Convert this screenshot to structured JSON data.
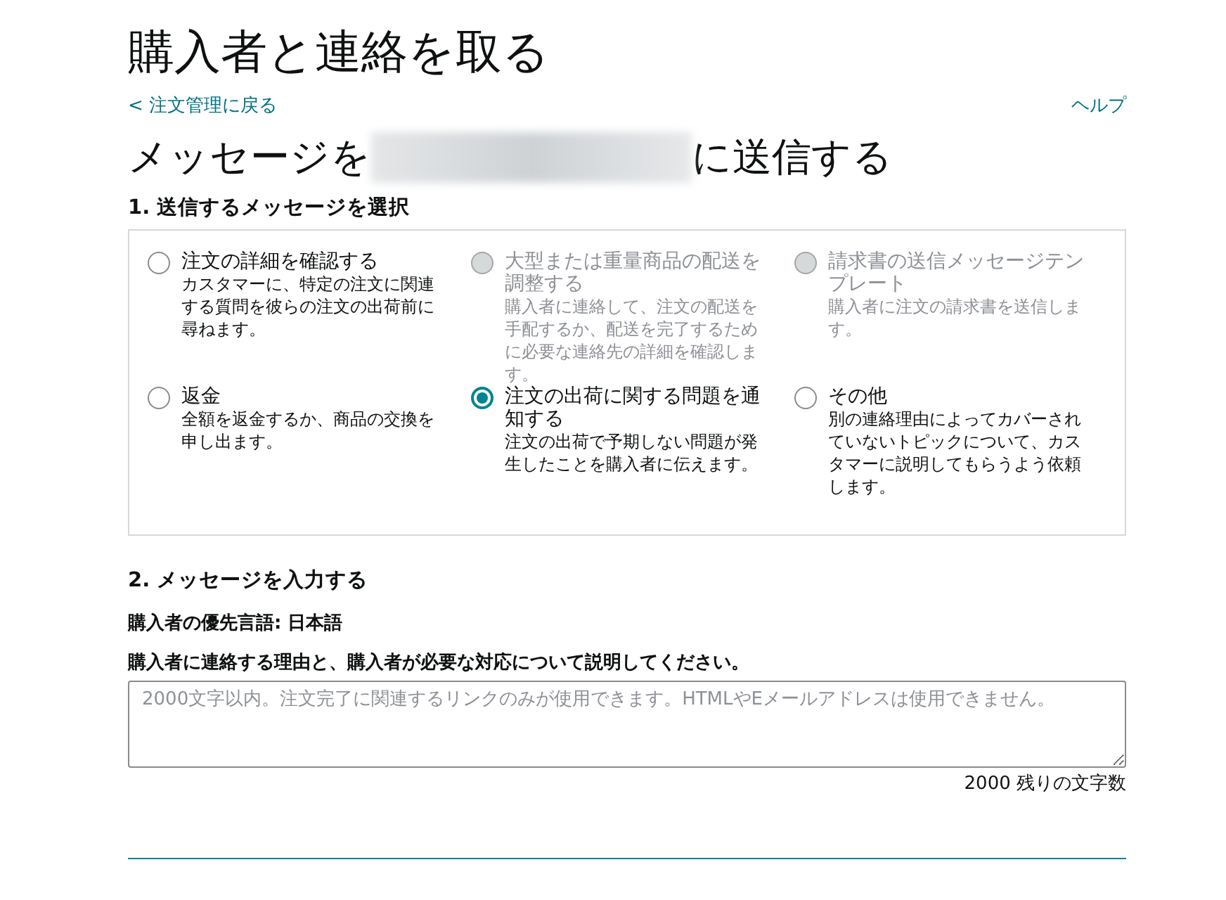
{
  "page_title": "購入者と連絡を取る",
  "back_link": "< 注文管理に戻る",
  "help_link": "ヘルプ",
  "heading": {
    "prefix": "メッセージを",
    "suffix": "に送信する"
  },
  "step1": {
    "title": "1. 送信するメッセージを選択",
    "options": [
      {
        "label": "注文の詳細を確認する",
        "description": "カスタマーに、特定の注文に関連する質問を彼らの注文の出荷前に尋ねます。",
        "selected": false,
        "disabled": false
      },
      {
        "label": "大型または重量商品の配送を調整する",
        "description": "購入者に連絡して、注文の配送を手配するか、配送を完了するために必要な連絡先の詳細を確認します。",
        "selected": false,
        "disabled": true
      },
      {
        "label": "請求書の送信メッセージテンプレート",
        "description": "購入者に注文の請求書を送信します。",
        "selected": false,
        "disabled": true
      },
      {
        "label": "返金",
        "description": "全額を返金するか、商品の交換を申し出ます。",
        "selected": false,
        "disabled": false
      },
      {
        "label": "注文の出荷に関する問題を通知する",
        "description": "注文の出荷で予期しない問題が発生したことを購入者に伝えます。",
        "selected": true,
        "disabled": false
      },
      {
        "label": "その他",
        "description": "別の連絡理由によってカバーされていないトピックについて、カスタマーに説明してもらうよう依頼します。",
        "selected": false,
        "disabled": false
      }
    ]
  },
  "step2": {
    "title": "2. メッセージを入力する",
    "language": "購入者の優先言語: 日本語",
    "prompt": "購入者に連絡する理由と、購入者が必要な対応について説明してください。",
    "message": {
      "placeholder": "2000文字以内。注文完了に関連するリンクのみが使用できます。HTMLやEメールアドレスは使用できません。"
    },
    "counter": "2000 残りの文字数"
  }
}
